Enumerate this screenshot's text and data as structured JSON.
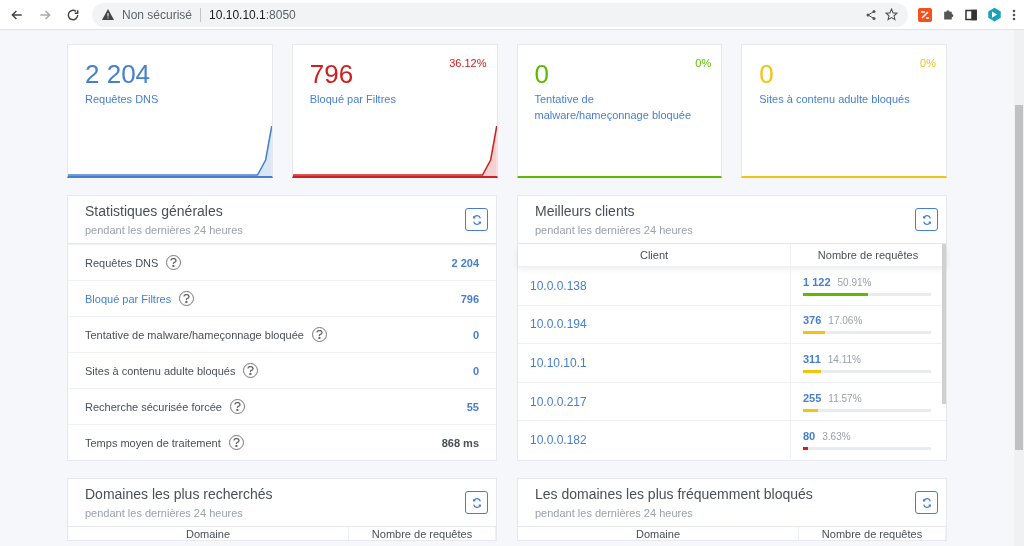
{
  "browser": {
    "security": "Non sécurisé",
    "host": "10.10.10.1",
    "port": ":8050"
  },
  "cards": [
    {
      "value": "2 204",
      "label": "Requêtes DNS",
      "color": "#467fcf"
    },
    {
      "value": "796",
      "label": "Bloqué par Filtres",
      "percent": "36.12%",
      "color": "#cd201f"
    },
    {
      "value": "0",
      "label": "Tentative de malware/hameçonnage bloquée",
      "percent": "0%",
      "color": "#5eba00"
    },
    {
      "value": "0",
      "label": "Sites à contenu adulte bloqués",
      "percent": "0%",
      "color": "#f1c40f"
    }
  ],
  "stats": {
    "title": "Statistiques générales",
    "subtitle": "pendant les dernières 24 heures",
    "rows": [
      {
        "label": "Requêtes DNS",
        "value": "2 204",
        "link": false,
        "accent": true
      },
      {
        "label": "Bloqué par Filtres",
        "value": "796",
        "link": true,
        "accent": true
      },
      {
        "label": "Tentative de malware/hameçonnage bloquée",
        "value": "0",
        "link": false,
        "accent": true
      },
      {
        "label": "Sites à contenu adulte bloqués",
        "value": "0",
        "link": false,
        "accent": true
      },
      {
        "label": "Recherche sécurisée forcée",
        "value": "55",
        "link": false,
        "accent": true
      },
      {
        "label": "Temps moyen de traitement",
        "value": "868 ms",
        "link": false,
        "accent": false
      }
    ]
  },
  "clients": {
    "title": "Meilleurs clients",
    "subtitle": "pendant les dernières 24 heures",
    "columns": [
      "Client",
      "Nombre de requêtes"
    ],
    "rows": [
      {
        "client": "10.0.0.138",
        "count": "1 122",
        "percent": "50.91%",
        "level": 0.5091,
        "color": "#5eba00"
      },
      {
        "client": "10.0.0.194",
        "count": "376",
        "percent": "17.06%",
        "level": 0.1706,
        "color": "#f1c40f"
      },
      {
        "client": "10.10.10.1",
        "count": "311",
        "percent": "14.11%",
        "level": 0.1411,
        "color": "#f1c40f"
      },
      {
        "client": "10.0.0.217",
        "count": "255",
        "percent": "11.57%",
        "level": 0.1157,
        "color": "#f1c40f"
      },
      {
        "client": "10.0.0.182",
        "count": "80",
        "percent": "3.63%",
        "level": 0.0363,
        "color": "#cd201f"
      }
    ]
  },
  "bottom_panels": [
    {
      "title": "Domaines les plus recherchés",
      "subtitle": "pendant les dernières 24 heures",
      "columns": [
        "Domaine",
        "Nombre de requêtes"
      ]
    },
    {
      "title": "Les domaines les plus fréquemment bloqués",
      "subtitle": "pendant les dernières 24 heures",
      "columns": [
        "Domaine",
        "Nombre de requêtes"
      ]
    }
  ]
}
